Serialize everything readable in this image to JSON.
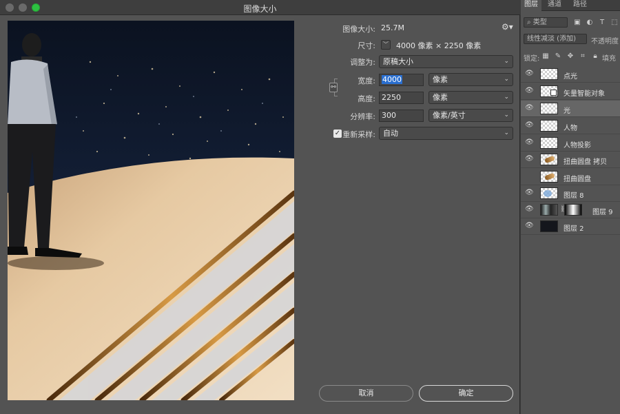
{
  "dialog": {
    "title": "图像大小",
    "image_size_label": "图像大小:",
    "image_size_value": "25.7M",
    "dimensions_label": "尺寸:",
    "dimensions_value": "4000 像素 × 2250 像素",
    "fit_to_label": "调整为:",
    "fit_to_value": "原稿大小",
    "width_label": "宽度:",
    "width_value": "4000",
    "width_unit": "像素",
    "height_label": "高度:",
    "height_value": "2250",
    "height_unit": "像素",
    "resolution_label": "分辨率:",
    "resolution_value": "300",
    "resolution_unit": "像素/英寸",
    "resample_label": "重新采样:",
    "resample_checked": true,
    "resample_value": "自动",
    "cancel_label": "取消",
    "ok_label": "确定"
  },
  "layers_panel": {
    "tabs": [
      "图层",
      "通道",
      "路径"
    ],
    "active_tab": 0,
    "filter_kind": "类型",
    "blend_mode": "线性减淡 (添加)",
    "opacity_label": "不透明度",
    "lock_label": "锁定:",
    "fill_label": "填充",
    "layers": [
      {
        "name": "点光",
        "visible": true,
        "thumb": "checker"
      },
      {
        "name": "矢量智能对象",
        "visible": true,
        "thumb": "smart"
      },
      {
        "name": "光",
        "visible": true,
        "thumb": "checker",
        "selected": true
      },
      {
        "name": "人物",
        "visible": true,
        "thumb": "checker"
      },
      {
        "name": "人物投影",
        "visible": true,
        "thumb": "checker"
      },
      {
        "name": "扭曲圆盘 拷贝",
        "visible": true,
        "thumb": "curl"
      },
      {
        "name": "扭曲圆盘",
        "visible": false,
        "thumb": "curl"
      },
      {
        "name": "图层 8",
        "visible": true,
        "thumb": "blueglow"
      },
      {
        "name": "图层 9",
        "visible": true,
        "thumb": "photo",
        "has_mask": true
      },
      {
        "name": "图层 2",
        "visible": true,
        "thumb": "dark"
      }
    ]
  },
  "colors": {
    "accent": "#2a6fd0",
    "dialog_bg": "#535353",
    "green_button": "#2dc041"
  }
}
